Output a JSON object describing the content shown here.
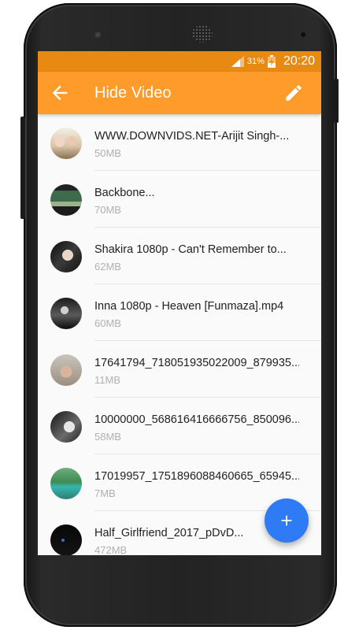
{
  "status_bar": {
    "battery_percent": "31%",
    "time": "20:20",
    "signal_icon": "signal-icon",
    "battery_icon": "battery-charging-icon"
  },
  "app_bar": {
    "title": "Hide Video",
    "back_icon": "arrow-back-icon",
    "action_icon": "edit-pencil-icon"
  },
  "colors": {
    "status_bar": "#e88a12",
    "app_bar": "#ff9b2a",
    "fab": "#2f7bf5",
    "list_background": "#fafafa",
    "secondary_text": "#b0b0b0"
  },
  "videos": [
    {
      "title": "WWW.DOWNVIDS.NET-Arijit Singh-...",
      "size": "50MB"
    },
    {
      "title": "Backbone...",
      "size": "70MB"
    },
    {
      "title": "Shakira 1080p - Can't Remember to...",
      "size": "62MB"
    },
    {
      "title": "Inna 1080p - Heaven [Funmaza].mp4",
      "size": "60MB"
    },
    {
      "title": "17641794_718051935022009_879935...",
      "size": "11MB"
    },
    {
      "title": "10000000_568616416666756_850096...",
      "size": "58MB"
    },
    {
      "title": "17019957_1751896088460665_65945...",
      "size": "7MB"
    },
    {
      "title": "Half_Girlfriend_2017_pDvD...",
      "size": "472MB"
    }
  ],
  "fab": {
    "icon": "plus-icon"
  }
}
